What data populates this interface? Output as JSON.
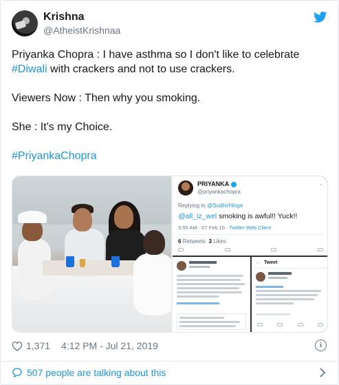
{
  "user": {
    "name": "Krishna",
    "handle": "@AtheistKrishnaa"
  },
  "tweet": {
    "line1_prefix": "Priyanka Chopra : I have asthma so I don't like to celebrate",
    "line1_hashtag": "#Diwali",
    "line1_suffix": " with crackers and not to use crackers.",
    "line2": "Viewers Now : Then why you smoking.",
    "line3": "She : It's my Choice.",
    "hashtag": "#PriyankaChopra"
  },
  "media": {
    "embedded_tweet": {
      "name": "PRIYANKA",
      "handle": "@priyankachopra",
      "replying_prefix": "Replying to ",
      "replying_to": "@SudhirHinge",
      "mention": "@all_iz_wel",
      "text": " smoking is awful!! Yuck!!",
      "time": "3:55 AM · 07 Feb 10 · ",
      "client": "Twitter Web Client",
      "retweets_count": "6",
      "retweets_label": "Retweets",
      "likes_count": "3",
      "likes_label": "Likes"
    },
    "right_shot_back": "←",
    "right_shot_title": "Tweet"
  },
  "footer": {
    "likes": "1,371",
    "timestamp": "4:12 PM - Jul 21, 2019",
    "info_glyph": "i",
    "talking": "507 people are talking about this"
  },
  "colors": {
    "accent": "#1b95e0",
    "twitter_blue": "#1da1f2",
    "text": "#14171a",
    "secondary": "#657786"
  },
  "icons": {
    "bird": "twitter-bird-icon",
    "heart": "heart-icon",
    "info": "info-icon",
    "bubble": "speech-bubble-icon",
    "chevron": "chevron-right-icon"
  }
}
